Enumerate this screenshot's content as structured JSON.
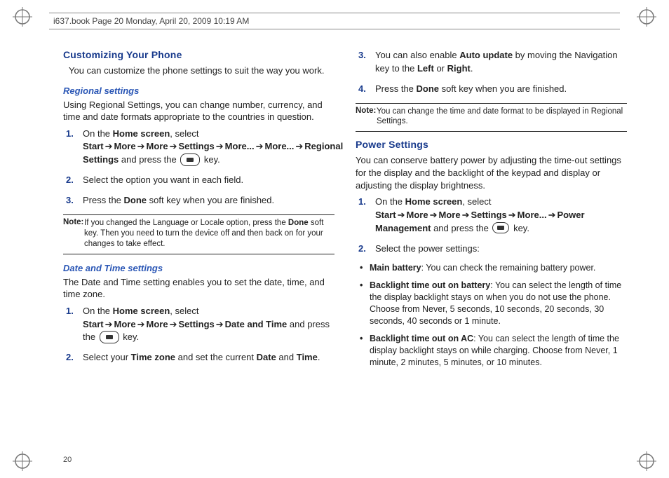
{
  "header": {
    "crop_info": "i637.book  Page 20  Monday, April 20, 2009  10:19 AM"
  },
  "page_number": "20",
  "left": {
    "h_customizing": "Customizing Your Phone",
    "p_customizing_intro": "You can customize the phone settings to suit the way you work.",
    "h_regional": "Regional settings",
    "p_regional_intro": "Using Regional Settings, you can change number, currency, and time and date formats appropriate to the countries in question.",
    "regional_steps": {
      "s1_a": "On the ",
      "s1_home": "Home screen",
      "s1_b": ", select ",
      "s1_start": "Start",
      "s1_more1": "More",
      "s1_more2": "More",
      "s1_settings": "Settings",
      "s1_more3": "More...",
      "s1_more4": "More...",
      "s1_regset": "Regional Settings",
      "s1_c": " and press the ",
      "s1_d": " key.",
      "s2": "Select the option you want in each field.",
      "s3_a": "Press the ",
      "s3_done": "Done",
      "s3_b": " soft key when you are finished."
    },
    "note1_label": "Note:",
    "note1_text_a": "If you changed the Language or Locale option, press the ",
    "note1_done": "Done",
    "note1_text_b": " soft key. Then you need to turn the device off and then back on for your changes to take effect.",
    "h_datetime": "Date and Time settings",
    "p_datetime_intro": "The Date and Time setting enables you to set the date, time, and time zone.",
    "dt_steps": {
      "s1_a": "On the ",
      "s1_home": "Home screen",
      "s1_b": ", select ",
      "s1_start": "Start",
      "s1_more1": "More",
      "s1_more2": "More",
      "s1_settings": "Settings",
      "s1_dt": "Date and Time",
      "s1_c": " and press the ",
      "s1_d": " key.",
      "s2_a": "Select your ",
      "s2_tz": "Time zone",
      "s2_b": " and set the current ",
      "s2_date": "Date",
      "s2_c": " and ",
      "s2_time": "Time",
      "s2_d": "."
    }
  },
  "right": {
    "cont_steps": {
      "s3_a": "You can also enable ",
      "s3_auto": "Auto update",
      "s3_b": " by moving the Navigation key to the ",
      "s3_left": "Left",
      "s3_c": " or ",
      "s3_right": "Right",
      "s3_d": ".",
      "s4_a": "Press the ",
      "s4_done": "Done",
      "s4_b": " soft key when you are finished."
    },
    "note2_label": "Note:",
    "note2_text": "You can change the time and date format to be displayed in Regional Settings.",
    "h_power": "Power Settings",
    "p_power_intro": "You can conserve battery power by adjusting the time-out settings for the display and the backlight of the keypad and display or adjusting the display brightness.",
    "power_steps": {
      "s1_a": "On the ",
      "s1_home": "Home screen",
      "s1_b": ", select ",
      "s1_start": "Start",
      "s1_more1": "More",
      "s1_more2": "More",
      "s1_settings": "Settings",
      "s1_more3": "More...",
      "s1_pm": "Power Management",
      "s1_c": " and press the ",
      "s1_d": " key.",
      "s2": "Select the power settings:"
    },
    "bullets": {
      "b1_t": "Main battery",
      "b1_r": ": You can check the remaining battery power.",
      "b2_t": "Backlight time out on battery",
      "b2_r": ": You can select the length of time the display backlight stays on when you do not use the phone. Choose from Never, 5 seconds, 10 seconds, 20 seconds, 30 seconds, 40 seconds or 1 minute.",
      "b3_t": "Backlight time out on AC",
      "b3_r": ": You can select the length of time the display backlight stays on while charging. Choose from Never, 1 minute, 2 minutes, 5 minutes, or 10 minutes."
    }
  },
  "glyphs": {
    "arrow": "➔"
  }
}
